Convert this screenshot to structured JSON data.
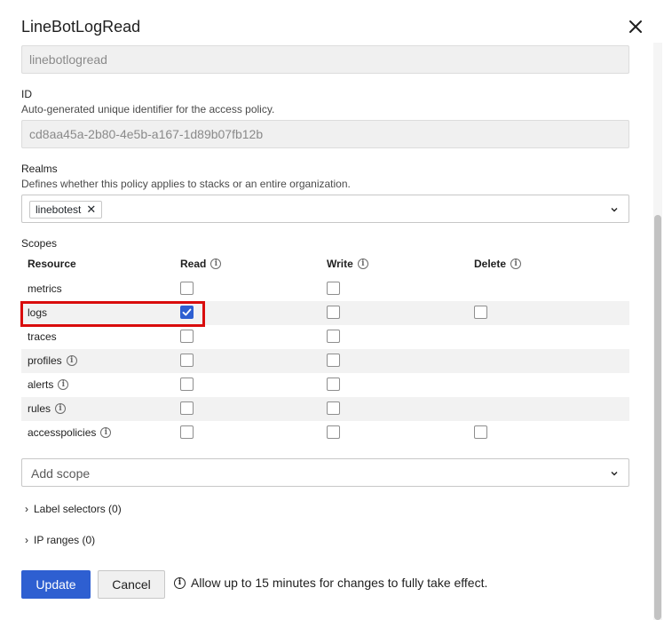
{
  "dialog": {
    "title": "LineBotLogRead"
  },
  "name_field": {
    "value": "linebotlogread"
  },
  "id_field": {
    "label": "ID",
    "description": "Auto-generated unique identifier for the access policy.",
    "value": "cd8aa45a-2b80-4e5b-a167-1d89b07fb12b"
  },
  "realms": {
    "label": "Realms",
    "description": "Defines whether this policy applies to stacks or an entire organization.",
    "tags": [
      "linebotest"
    ]
  },
  "scopes": {
    "label": "Scopes",
    "columns": [
      "Resource",
      "Read",
      "Write",
      "Delete"
    ],
    "rows": [
      {
        "name": "metrics",
        "info": false,
        "read": false,
        "write": false,
        "delete": null
      },
      {
        "name": "logs",
        "info": false,
        "read": true,
        "write": false,
        "delete": false
      },
      {
        "name": "traces",
        "info": false,
        "read": false,
        "write": false,
        "delete": null
      },
      {
        "name": "profiles",
        "info": true,
        "read": false,
        "write": false,
        "delete": null
      },
      {
        "name": "alerts",
        "info": true,
        "read": false,
        "write": false,
        "delete": null
      },
      {
        "name": "rules",
        "info": true,
        "read": false,
        "write": false,
        "delete": null
      },
      {
        "name": "accesspolicies",
        "info": true,
        "read": false,
        "write": false,
        "delete": false
      }
    ],
    "add_scope_placeholder": "Add scope"
  },
  "label_selectors": "Label selectors (0)",
  "ip_ranges": "IP ranges (0)",
  "actions": {
    "update": "Update",
    "cancel": "Cancel",
    "notice": "Allow up to 15 minutes for changes to fully take effect."
  },
  "colors": {
    "primary": "#2e5fd1",
    "highlight": "#d90c0c"
  }
}
